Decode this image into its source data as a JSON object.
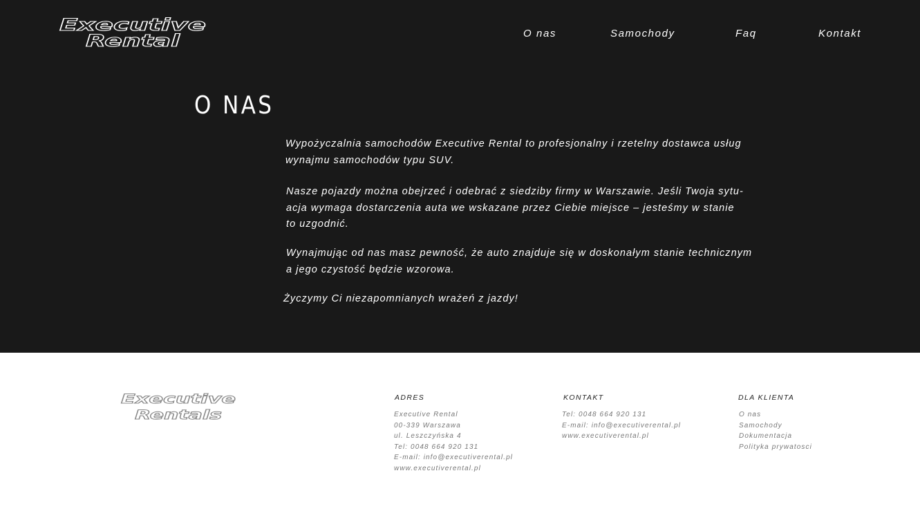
{
  "header": {
    "logo_line1": "Executive",
    "logo_line2": "Rental",
    "nav": [
      {
        "label": "O nas"
      },
      {
        "label": "Samochody"
      },
      {
        "label": "Faq"
      },
      {
        "label": "Kontakt"
      }
    ]
  },
  "about": {
    "title": "O NAS",
    "paragraph1": [
      "Wypożyczalnia samochodów Executive Rental to profesjonalny i rzetelny dostawca usług",
      "wynajmu samochodów typu SUV."
    ],
    "paragraph2": [
      "Nasze pojazdy można obejrzeć i odebrać z siedziby firmy w Warszawie. Jeśli Twoja sytu-",
      "acja wymaga dostarczenia auta we wskazane przez Ciebie miejsce – jesteśmy w stanie",
      "to uzgodnić."
    ],
    "paragraph3": [
      "Wynajmując od nas masz pewność, że auto znajduje się w doskonałym stanie technicznym",
      "a jego czystość będzie wzorowa."
    ],
    "paragraph4": "Życzymy Ci niezapomnianych wrażeń z jazdy!"
  },
  "footer": {
    "logo_line1": "Executive",
    "logo_line2": "Rentals",
    "address": {
      "heading": "ADRES",
      "lines": [
        "Executive Rental",
        "00-339 Warszawa",
        "ul. Leszczyńska 4",
        "Tel: 0048 664 920 131",
        "E-mail: info@executiverental.pl",
        "www.executiverental.pl"
      ]
    },
    "contact": {
      "heading": "KONTAKT",
      "lines": [
        "Tel: 0048 664 920 131",
        "E-mail: info@executiverental.pl",
        "www.executiverental.pl"
      ]
    },
    "client": {
      "heading": "DLA KLIENTA",
      "links": [
        "O nas",
        "Samochody",
        "Dokumentacja",
        "Polityka prywatosci"
      ]
    }
  },
  "colors": {
    "header_background": "#191919",
    "footer_background": "#ffffff",
    "text_light": "#ffffff",
    "footer_text": "#777777"
  }
}
